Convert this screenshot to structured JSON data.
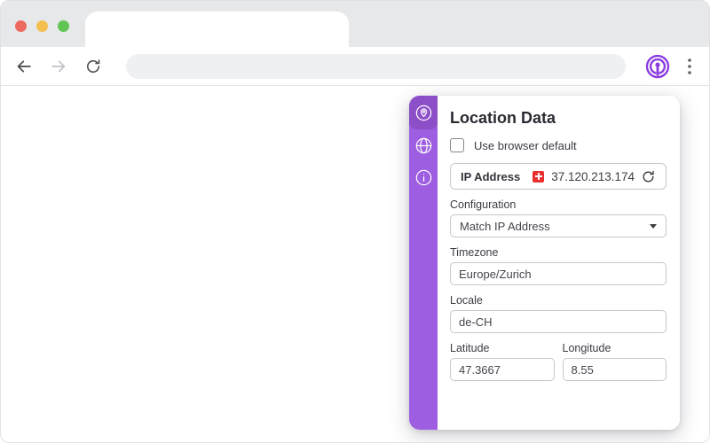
{
  "browser": {
    "traffic_lights": [
      {
        "name": "close",
        "color": "#ee6a5f"
      },
      {
        "name": "minimize",
        "color": "#f5bf4f"
      },
      {
        "name": "maximize",
        "color": "#61c454"
      }
    ],
    "tab_title": "",
    "address_bar": {
      "value": "",
      "placeholder": ""
    },
    "nav_icons": [
      "back-arrow",
      "forward-arrow",
      "reload"
    ],
    "extension_icon": "location-spoofer-extension-logo",
    "menu_icon": "kebab-menu"
  },
  "popup": {
    "title": "Location Data",
    "use_browser_default": {
      "label": "Use browser default",
      "checked": false
    },
    "ip": {
      "label": "IP Address",
      "value": "37.120.213.174",
      "flag": "switzerland"
    },
    "configuration": {
      "label": "Configuration",
      "value": "Match IP Address"
    },
    "timezone": {
      "label": "Timezone",
      "value": "Europe/Zurich"
    },
    "locale": {
      "label": "Locale",
      "value": "de-CH"
    },
    "latitude": {
      "label": "Latitude",
      "value": "47.3667"
    },
    "longitude": {
      "label": "Longitude",
      "value": "8.55"
    },
    "sidebar": {
      "items": [
        {
          "icon": "location-pin",
          "active": true
        },
        {
          "icon": "globe",
          "active": false
        },
        {
          "icon": "info",
          "active": false
        }
      ]
    }
  },
  "colors": {
    "sidebar_purple": "#9e5ee2",
    "sidebar_active_purple": "#8d4fc8",
    "accent_purple": "#8a3ce0",
    "swiss_flag_red": "#e8312e",
    "traffic_red": "#ee6a5f",
    "traffic_yellow": "#f5bf4f",
    "traffic_green": "#61c454"
  }
}
